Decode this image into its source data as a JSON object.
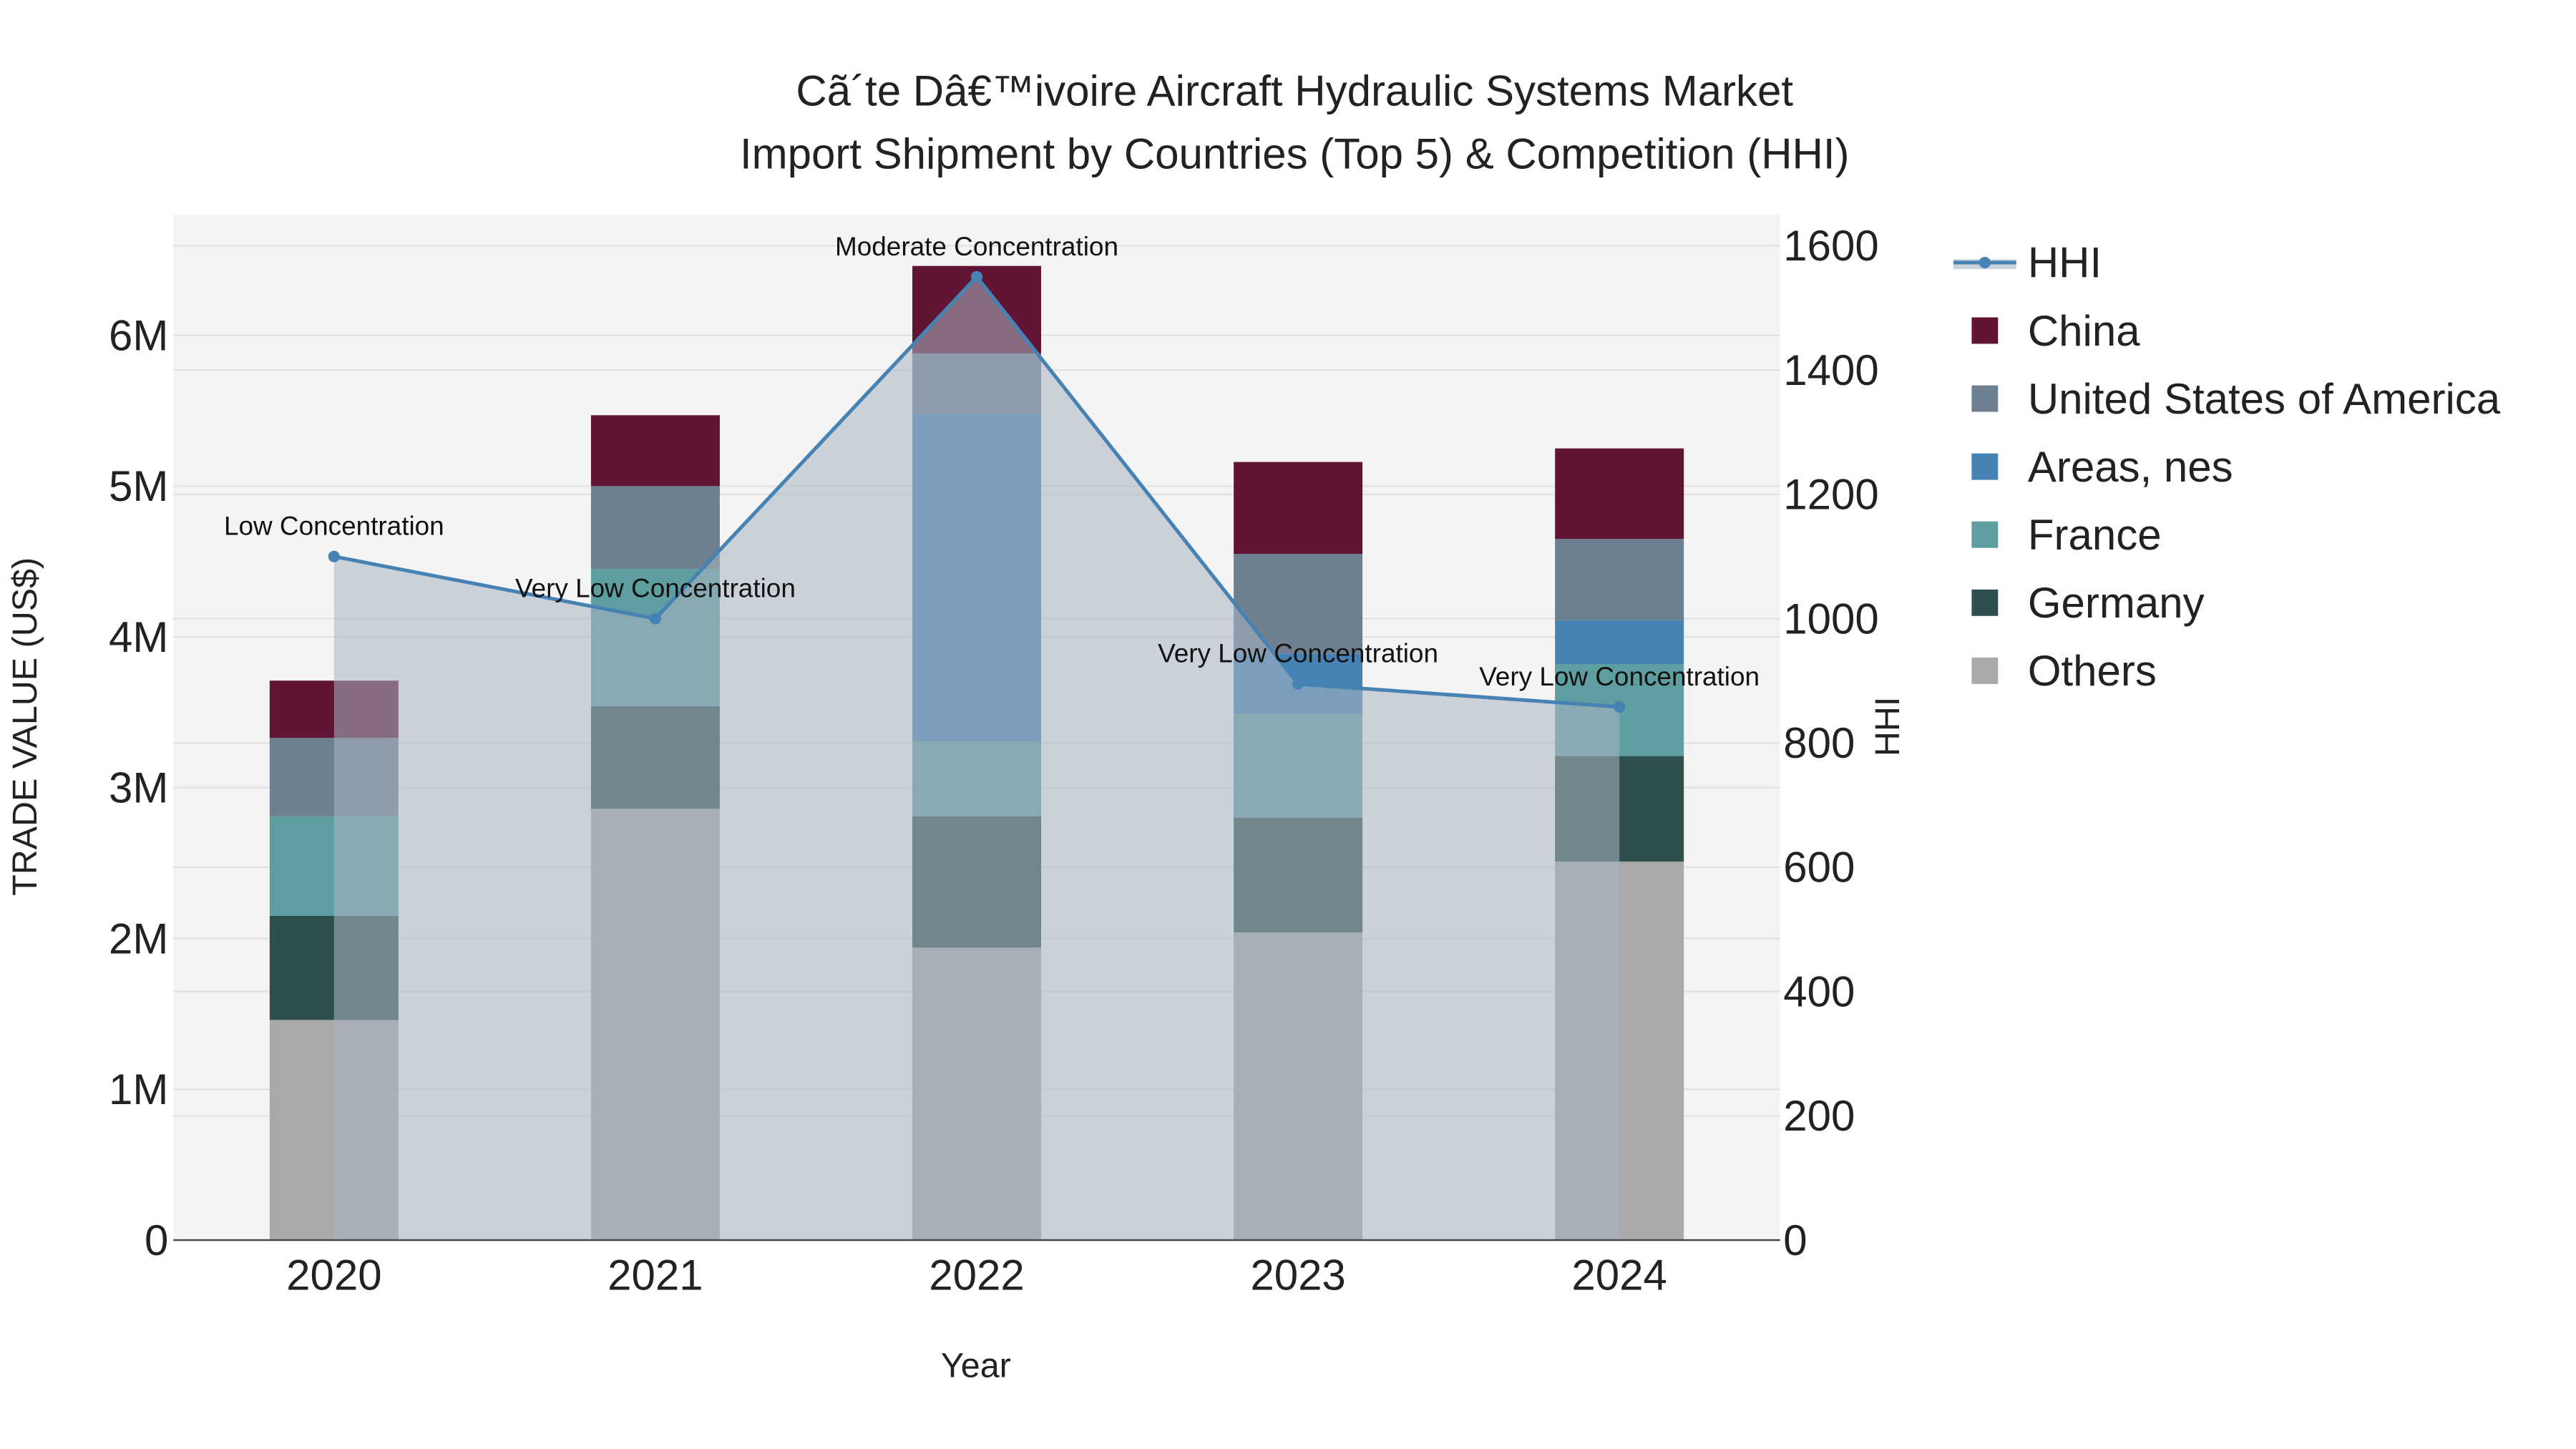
{
  "chart_data": {
    "type": "bar",
    "stacked": true,
    "title_line1": "Cã´te Dâ€™ivoire Aircraft Hydraulic Systems Market",
    "title_line2": "Import Shipment by Countries (Top 5) & Competition (HHI)",
    "xlabel": "Year",
    "ylabel": "TRADE VALUE (US$)",
    "y2label": "HHI",
    "categories": [
      "2020",
      "2021",
      "2022",
      "2023",
      "2024"
    ],
    "ylim": [
      0,
      6800000
    ],
    "y_ticks": [
      0,
      1000000,
      2000000,
      3000000,
      4000000,
      5000000,
      6000000
    ],
    "y_tick_labels": [
      "0",
      "1M",
      "2M",
      "3M",
      "4M",
      "5M",
      "6M"
    ],
    "y2lim": [
      0,
      1650
    ],
    "y2_ticks": [
      0,
      200,
      400,
      600,
      800,
      1000,
      1200,
      1400,
      1600
    ],
    "y2_tick_labels": [
      "0",
      "200",
      "400",
      "600",
      "800",
      "1000",
      "1200",
      "1400",
      "1600"
    ],
    "series": [
      {
        "name": "Others",
        "color": "#a9a9a9",
        "values": [
          1460000,
          2860000,
          1940000,
          2040000,
          2510000
        ]
      },
      {
        "name": "Germany",
        "color": "#2f4f4f",
        "values": [
          690000,
          680000,
          870000,
          760000,
          700000
        ]
      },
      {
        "name": "France",
        "color": "#5f9ea0",
        "values": [
          660000,
          910000,
          500000,
          690000,
          610000
        ]
      },
      {
        "name": "Areas, nes",
        "color": "#4682b4",
        "values": [
          0,
          0,
          2170000,
          400000,
          290000
        ]
      },
      {
        "name": "United States of America",
        "color": "#6e7f8f",
        "values": [
          520000,
          550000,
          400000,
          660000,
          540000
        ]
      },
      {
        "name": "China",
        "color": "#611434",
        "values": [
          380000,
          470000,
          580000,
          610000,
          600000
        ]
      }
    ],
    "legend_order": [
      "HHI",
      "China",
      "United States of America",
      "Areas, nes",
      "France",
      "Germany",
      "Others"
    ],
    "legend_position": "right",
    "hhi": {
      "name": "HHI",
      "color": "#4682b4",
      "values": [
        1100,
        1000,
        1550,
        895,
        858
      ],
      "labels": [
        "Low Concentration",
        "Very Low Concentration",
        "Moderate Concentration",
        "Very Low Concentration",
        "Very Low Concentration"
      ]
    }
  }
}
